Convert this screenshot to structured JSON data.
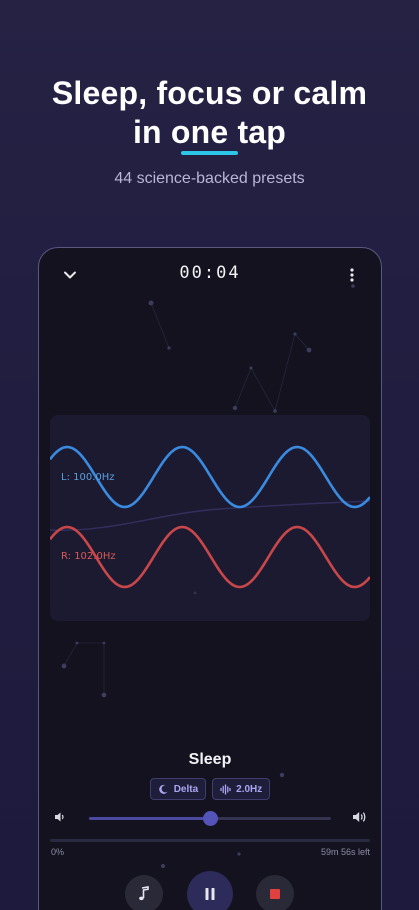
{
  "promo": {
    "headline_line1": "Sleep, focus or calm",
    "headline_line2": "in one tap",
    "subtitle": "44 science-backed presets",
    "accent_color": "#2cc6e6"
  },
  "player": {
    "timer": "00:04",
    "collapse_icon": "chevron-down-icon",
    "menu_icon": "more-vertical-icon",
    "waves": {
      "left_label": "L: 100.0Hz",
      "right_label": "R: 102.0Hz",
      "left_color": "#3a8be0",
      "right_color": "#c8474a"
    },
    "preset_name": "Sleep",
    "chips": [
      {
        "icon": "moon-icon",
        "label": "Delta"
      },
      {
        "icon": "waveform-icon",
        "label": "2.0Hz"
      }
    ],
    "volume": {
      "low_icon": "volume-low-icon",
      "high_icon": "volume-high-icon",
      "level": 0.5
    },
    "progress": {
      "start_label": "0%",
      "remaining_label": "59m 56s left",
      "fraction": 0.0
    },
    "controls": [
      {
        "icon": "music-note-icon"
      },
      {
        "icon": "pause-icon"
      },
      {
        "icon": "stop-icon",
        "color": "#e0413e"
      }
    ]
  }
}
